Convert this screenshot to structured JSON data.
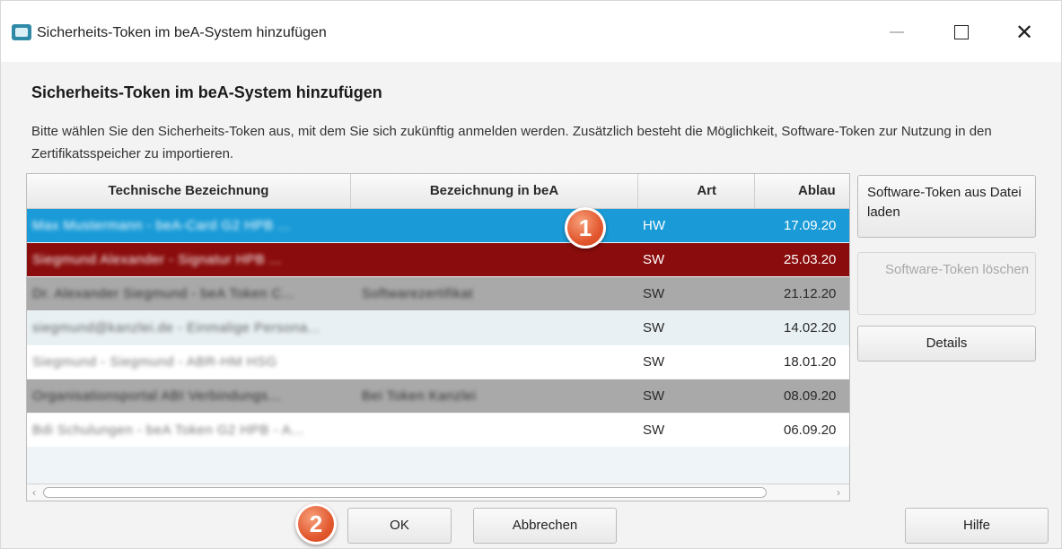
{
  "window": {
    "title": "Sicherheits-Token im beA-System hinzufügen",
    "controls": [
      "minimize",
      "maximize",
      "close"
    ],
    "close_glyph": "✕"
  },
  "dialog": {
    "heading": "Sicherheits-Token im beA-System hinzufügen",
    "description": "Bitte wählen Sie den Sicherheits-Token aus, mit dem Sie sich zukünftig anmelden werden. Zusätzlich besteht die Möglichkeit, Software-Token zur Nutzung in den Zertifikatsspeicher zu importieren."
  },
  "table": {
    "columns": [
      "Technische Bezeichnung",
      "Bezeichnung in beA",
      "Art",
      "Ablau"
    ],
    "rows": [
      {
        "tech": "Max Mustermann - beA-Card G2 HPB ...",
        "bea": "",
        "art": "HW",
        "ablauf": "17.09.20",
        "style": "selected"
      },
      {
        "tech": "Siegmund Alexander - Signatur HPB ...",
        "bea": "",
        "art": "SW",
        "ablauf": "25.03.20",
        "style": "highlight"
      },
      {
        "tech": "Dr. Alexander Siegmund - beA Token C...",
        "bea": "Softwarezertifikat",
        "art": "SW",
        "ablauf": "21.12.20",
        "style": "gray"
      },
      {
        "tech": "siegmund@kanzlei.de - Einmalige Persona...",
        "bea": "",
        "art": "SW",
        "ablauf": "14.02.20",
        "style": "light"
      },
      {
        "tech": "Siegmund - Siegmund - ABR-HM HSG",
        "bea": "",
        "art": "SW",
        "ablauf": "18.01.20",
        "style": "white"
      },
      {
        "tech": "Organisationsportal ABI Verbindungs...",
        "bea": "Bei Token Kanzlei",
        "art": "SW",
        "ablauf": "08.09.20",
        "style": "gray"
      },
      {
        "tech": "Bdi Schulungen - beA Token G2 HPB - A...",
        "bea": "",
        "art": "SW",
        "ablauf": "06.09.20",
        "style": "white"
      }
    ]
  },
  "buttons": {
    "load": "Software-Token aus Datei laden",
    "delete": "Software-Token löschen",
    "details": "Details",
    "ok": "OK",
    "cancel": "Abbrechen",
    "help": "Hilfe"
  },
  "badges": {
    "one": "1",
    "two": "2"
  },
  "colors": {
    "selected_row": "#1a9bd7",
    "highlight_row": "#8b0c0c",
    "gray_row": "#a9a9a9",
    "light_row": "#e8f0f3",
    "badge": "#e2572e"
  }
}
